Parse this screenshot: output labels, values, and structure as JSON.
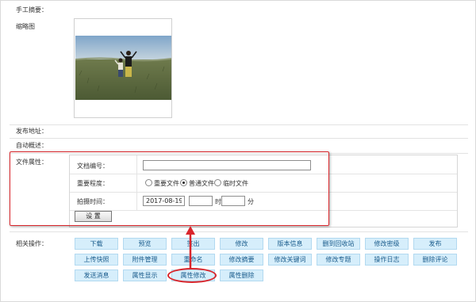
{
  "labels": {
    "manual_summary": "手工摘要：",
    "thumbnail": "缩略图",
    "publish_address": "发布地址：",
    "auto_summary": "自动概述：",
    "file_attributes": "文件属性：",
    "related_operations": "相关操作："
  },
  "attributes": {
    "doc_number_label": "文档编号：",
    "doc_number_value": "",
    "importance_label": "重要程度：",
    "importance_options": [
      "重要文件",
      "普通文件",
      "临时文件"
    ],
    "importance_selected": "普通文件",
    "shoot_time_label": "拍摄时间：",
    "shoot_date": "2017-08-19",
    "hour_value": "",
    "hour_unit": "时",
    "minute_value": "",
    "minute_unit": "分",
    "set_button": "设 置"
  },
  "operations": {
    "row1": [
      "下载",
      "预览",
      "签出",
      "修改",
      "版本信息",
      "删到回收站",
      "修改密级",
      "发布"
    ],
    "row2": [
      "上传快照",
      "附件管理",
      "重命名",
      "修改摘要",
      "修改关键词",
      "修改专题",
      "操作日志",
      "删除评论"
    ],
    "row3": [
      "发送消息",
      "属性显示",
      "属性修改",
      "属性删除"
    ]
  },
  "highlight_color": "#d9262c",
  "button_color": "#d6eefb"
}
